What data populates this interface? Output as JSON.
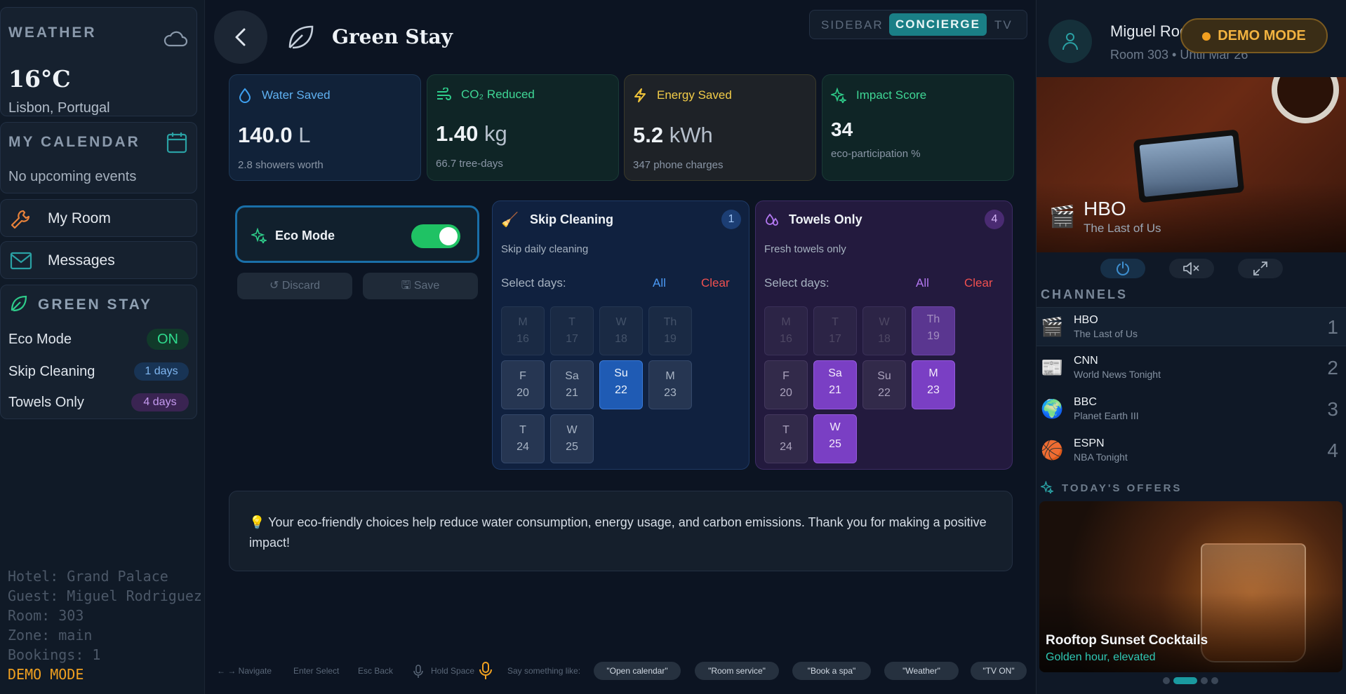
{
  "sidebar": {
    "weather": {
      "title": "WEATHER",
      "temp": "16°C",
      "location": "Lisbon, Portugal"
    },
    "calendar": {
      "title": "MY CALENDAR",
      "empty": "No upcoming events"
    },
    "nav": [
      {
        "label": "My Room"
      },
      {
        "label": "Messages"
      }
    ],
    "green": {
      "title": "GREEN STAY",
      "rows": [
        {
          "label": "Eco Mode",
          "badge": "ON"
        },
        {
          "label": "Skip Cleaning",
          "badge": "1 days"
        },
        {
          "label": "Towels Only",
          "badge": "4 days"
        }
      ]
    },
    "debug": [
      "Hotel: Grand Palace",
      "Guest: Miguel Rodriguez",
      "Room: 303",
      "Zone: main",
      "Bookings: 1"
    ],
    "demo": "DEMO MODE"
  },
  "header": {
    "title": "Green Stay",
    "modes": [
      "SIDEBAR",
      "CONCIERGE",
      "TV"
    ],
    "active_mode": "CONCIERGE"
  },
  "stats": [
    {
      "title": "Water Saved",
      "value": "140.0",
      "unit": "L",
      "sub": "2.8 showers worth",
      "color": "#3ea0f0"
    },
    {
      "title": "CO₂ Reduced",
      "value": "1.40",
      "unit": "kg",
      "sub": "66.7 tree-days",
      "color": "#2ecc8a"
    },
    {
      "title": "Energy Saved",
      "value": "5.2",
      "unit": "kWh",
      "sub": "347 phone charges",
      "color": "#f0c43a"
    },
    {
      "title": "Impact Score",
      "value": "34",
      "unit": "",
      "sub": "eco-participation %",
      "color": "#2ecc8a"
    }
  ],
  "eco": {
    "label": "Eco Mode",
    "on": true,
    "discard": "Discard",
    "save": "Save"
  },
  "skip": {
    "title": "Skip Cleaning",
    "count": "1",
    "desc": "Skip daily cleaning",
    "select": "Select days:",
    "all": "All",
    "clear": "Clear",
    "days": [
      {
        "d": "M",
        "n": "16"
      },
      {
        "d": "T",
        "n": "17"
      },
      {
        "d": "W",
        "n": "18"
      },
      {
        "d": "Th",
        "n": "19"
      },
      {
        "d": "F",
        "n": "20"
      },
      {
        "d": "Sa",
        "n": "21"
      },
      {
        "d": "Su",
        "n": "22"
      },
      {
        "d": "M",
        "n": "23"
      },
      {
        "d": "T",
        "n": "24"
      },
      {
        "d": "W",
        "n": "25"
      }
    ]
  },
  "towels": {
    "title": "Towels Only",
    "count": "4",
    "desc": "Fresh towels only",
    "select": "Select days:",
    "all": "All",
    "clear": "Clear",
    "days": [
      {
        "d": "M",
        "n": "16"
      },
      {
        "d": "T",
        "n": "17"
      },
      {
        "d": "W",
        "n": "18"
      },
      {
        "d": "Th",
        "n": "19"
      },
      {
        "d": "F",
        "n": "20"
      },
      {
        "d": "Sa",
        "n": "21"
      },
      {
        "d": "Su",
        "n": "22"
      },
      {
        "d": "M",
        "n": "23"
      },
      {
        "d": "T",
        "n": "24"
      },
      {
        "d": "W",
        "n": "25"
      }
    ]
  },
  "tip": "💡 Your eco-friendly choices help reduce water consumption, energy usage, and carbon emissions. Thank you for making a positive impact!",
  "footer": {
    "hints": [
      "← → Navigate",
      "Enter Select",
      "Esc Back",
      "Hold Space",
      "Say something like:"
    ],
    "chips": [
      "\"Open calendar\"",
      "\"Room service\"",
      "\"Book a spa\"",
      "\"Weather\"",
      "\"TV ON\""
    ]
  },
  "guest": {
    "name": "Miguel Rodriguez",
    "room": "Room 303 • Until Mar 26",
    "demo": "DEMO MODE"
  },
  "tv": {
    "channel": "HBO",
    "show": "The Last of Us"
  },
  "channels_title": "CHANNELS",
  "channels": [
    {
      "name": "HBO",
      "show": "The Last of Us",
      "num": "1",
      "icon": "🎬"
    },
    {
      "name": "CNN",
      "show": "World News Tonight",
      "num": "2",
      "icon": "📰"
    },
    {
      "name": "BBC",
      "show": "Planet Earth III",
      "num": "3",
      "icon": "🌍"
    },
    {
      "name": "ESPN",
      "show": "NBA Tonight",
      "num": "4",
      "icon": "🏀"
    }
  ],
  "offers": {
    "title": "TODAY'S OFFERS",
    "name": "Rooftop Sunset Cocktails",
    "sub": "Golden hour, elevated"
  }
}
